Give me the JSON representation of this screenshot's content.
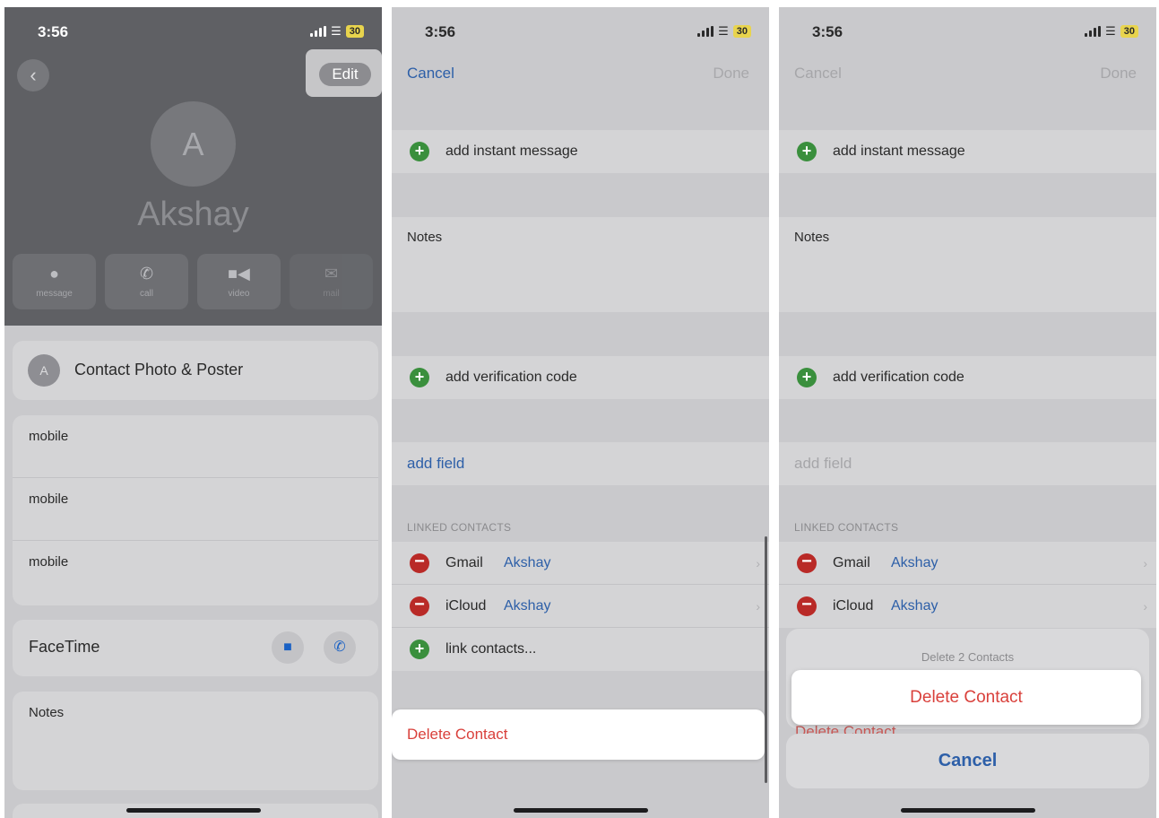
{
  "status": {
    "time": "3:56",
    "battery": "30"
  },
  "panel1": {
    "edit_label": "Edit",
    "avatar_initial": "A",
    "contact_name": "Akshay",
    "actions": [
      {
        "label": "message",
        "icon": "message-bubble-icon"
      },
      {
        "label": "call",
        "icon": "phone-icon"
      },
      {
        "label": "video",
        "icon": "video-camera-icon"
      },
      {
        "label": "mail",
        "icon": "mail-icon"
      }
    ],
    "photo_poster_initial": "A",
    "photo_poster_label": "Contact Photo & Poster",
    "mobile_rows": [
      "mobile",
      "mobile",
      "mobile"
    ],
    "facetime_label": "FaceTime",
    "notes_label": "Notes"
  },
  "panel2": {
    "cancel_label": "Cancel",
    "done_label": "Done",
    "add_instant_message": "add instant message",
    "notes_label": "Notes",
    "add_verification_code": "add verification code",
    "add_field": "add field",
    "linked_contacts_header": "LINKED CONTACTS",
    "linked": [
      {
        "source": "Gmail",
        "name": "Akshay"
      },
      {
        "source": "iCloud",
        "name": "Akshay"
      }
    ],
    "link_contacts": "link contacts...",
    "delete_contact": "Delete Contact"
  },
  "panel3": {
    "cancel_label": "Cancel",
    "done_label": "Done",
    "add_instant_message": "add instant message",
    "notes_label": "Notes",
    "add_verification_code": "add verification code",
    "add_field": "add field",
    "linked_contacts_header": "LINKED CONTACTS",
    "linked": [
      {
        "source": "Gmail",
        "name": "Akshay"
      },
      {
        "source": "iCloud",
        "name": "Akshay"
      }
    ],
    "sheet_title": "Delete 2 Contacts",
    "delete_contact": "Delete Contact",
    "ghost_delete": "Delete Contact",
    "sheet_cancel": "Cancel"
  },
  "colors": {
    "accent_blue": "#2d5fa8",
    "destructive_red": "#d9403b",
    "add_green": "#3a8f3d",
    "remove_red": "#b92a27"
  }
}
